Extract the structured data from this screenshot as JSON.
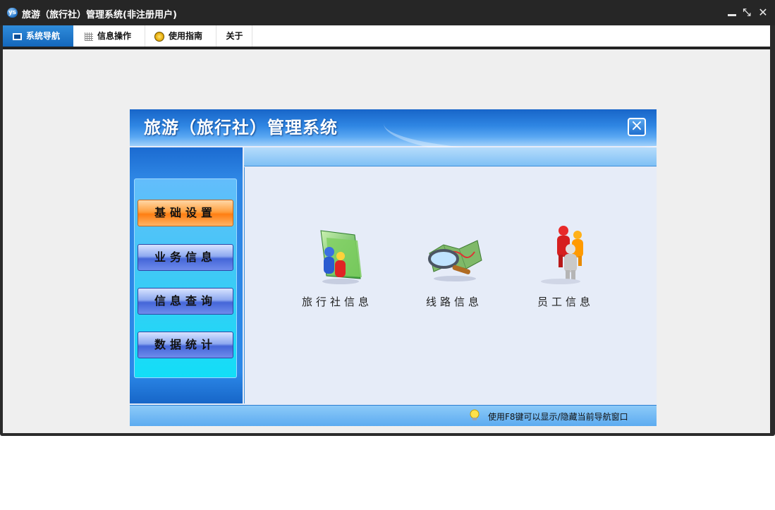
{
  "window": {
    "title": "旅游（旅行社）管理系统(非注册用户)",
    "app_icon": "ys"
  },
  "menubar": {
    "items": [
      {
        "label": "系统导航",
        "icon": "monitor-icon"
      },
      {
        "label": "信息操作",
        "icon": "grid-icon"
      },
      {
        "label": "使用指南",
        "icon": "bulb-icon"
      },
      {
        "label": "关于",
        "icon": ""
      }
    ]
  },
  "nav": {
    "title": "旅游（旅行社）管理系统",
    "sidebar": [
      {
        "label": "基础设置",
        "active": true
      },
      {
        "label": "业务信息",
        "active": false
      },
      {
        "label": "信息查询",
        "active": false
      },
      {
        "label": "数据统计",
        "active": false
      }
    ],
    "features": [
      {
        "label": "旅行社信息",
        "icon": "folder-people-icon"
      },
      {
        "label": "线路信息",
        "icon": "map-magnifier-icon"
      },
      {
        "label": "员工信息",
        "icon": "people-icon"
      }
    ],
    "status": "使用F8键可以显示/隐藏当前导航窗口"
  },
  "colors": {
    "accent": "#1467bb",
    "active_button": "#ff8a20",
    "nav_button": "#4566d8"
  }
}
